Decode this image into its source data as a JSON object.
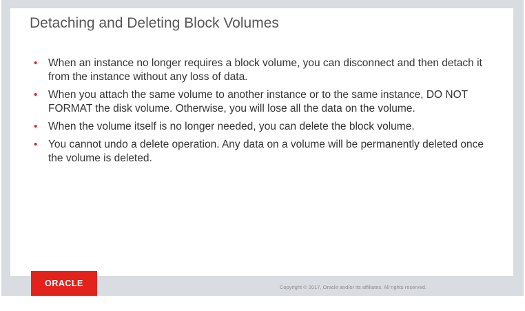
{
  "slide": {
    "title": "Detaching and Deleting Block Volumes",
    "bullet_marker": "•",
    "bullets": [
      "When an instance no longer requires a block volume, you can disconnect and then detach it from the instance without any loss of data.",
      "When you attach the same volume to another instance or to the same instance, DO NOT FORMAT the disk volume. Otherwise, you will lose all the data on the volume.",
      "When the volume itself is no longer needed, you can delete the block volume.",
      "You cannot undo a delete operation. Any data on a volume will be permanently deleted once the volume is deleted."
    ]
  },
  "footer": {
    "logo_text": "ORACLE",
    "copyright": "Copyright © 2017, Oracle and/or its affiliates. All rights reserved."
  },
  "colors": {
    "accent": "#e3231b",
    "frame": "#d9dce1",
    "title": "#555555",
    "body_text": "#333333"
  }
}
